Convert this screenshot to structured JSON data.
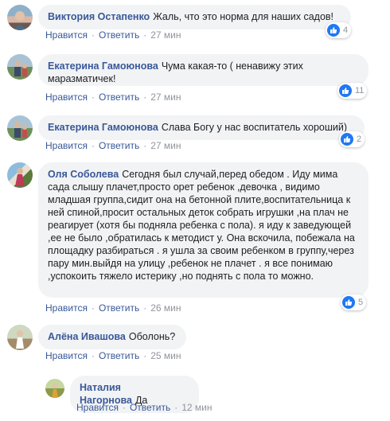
{
  "labels": {
    "like": "Нравится",
    "reply": "Ответить"
  },
  "comments": [
    {
      "author": "Виктория Остапенко",
      "text": "Жаль, что это норма для наших садов!",
      "time": "27 мин",
      "likes": "4"
    },
    {
      "author": "Екатерина Гамоюнова",
      "text": "Чума какая-то ( ненавижу этих маразматичек!",
      "time": "27 мин",
      "likes": "11"
    },
    {
      "author": "Екатерина Гамоюнова",
      "text": "Слава Богу у нас воспитатель хороший)",
      "time": "27 мин",
      "likes": "2"
    },
    {
      "author": "Оля Соболева",
      "text": "Сегодня был случай,перед обедом . Иду мима сада слышу плачет,просто орет ребенок ,девочка , видимо младшая группа,сидит она на бетонной плите,воспитательница к ней спиной,просит остальных деток собрать игрушки ,на плач не реагирует (хотя бы подняла ребенка с пола). я иду к заведующей ,ее не было ,обратилась к методист у. Она вскочила, побежала на площадку разбираться . я ушла за своим ребенком в группу,через пару мин.выйдя на улицу ,ребенок не плачет . я все понимаю ,успокоить тяжело истерику ,но поднять с пола то можно.",
      "time": "26 мин",
      "likes": "5"
    },
    {
      "author": "Алёна Ивашова",
      "text": "Оболонь?",
      "time": "25 мин"
    },
    {
      "author": "Наталия Нагорнова",
      "text": "Да",
      "time": "12 мин"
    }
  ],
  "colors": {
    "link": "#385898",
    "bubble": "#f2f3f5",
    "like": "#2078f4",
    "meta": "#90949c"
  }
}
